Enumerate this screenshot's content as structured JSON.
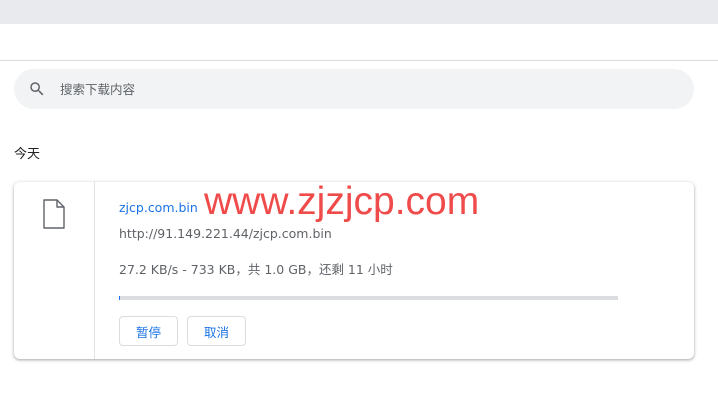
{
  "search": {
    "placeholder": "搜索下载内容",
    "icon": "search-icon"
  },
  "section": {
    "date_heading": "今天"
  },
  "download": {
    "file_icon": "file-icon",
    "file_name": "zjcp.com.bin",
    "url": "http://91.149.221.44/zjcp.com.bin",
    "status": "27.2 KB/s - 733 KB，共 1.0 GB，还剩 11 小时",
    "progress_fraction": 0.0007,
    "pause_label": "暂停",
    "cancel_label": "取消"
  },
  "watermark": {
    "text": "www.zjzjcp.com"
  },
  "colors": {
    "accent": "#1a73e8",
    "watermark": "#f04b4b",
    "search_bg": "#f1f3f4",
    "top_strip": "#e8eaed"
  }
}
